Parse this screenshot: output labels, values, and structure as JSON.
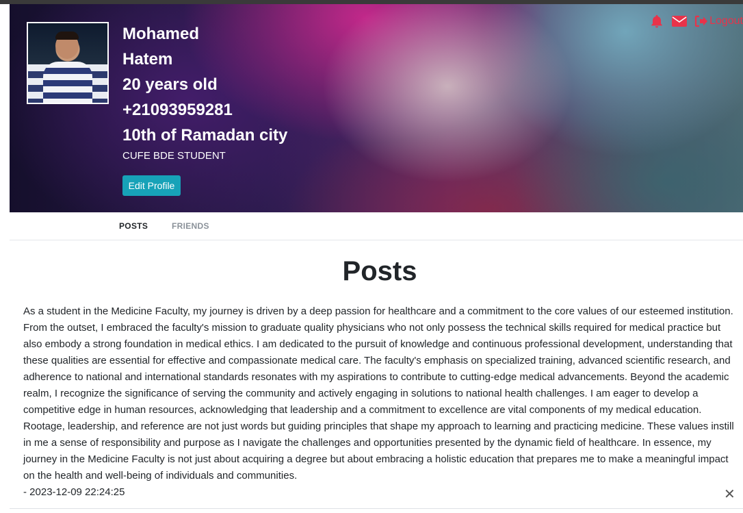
{
  "profile": {
    "first_name": "Mohamed",
    "last_name": "Hatem",
    "age": "20 years old",
    "phone": "+21093959281",
    "city": "10th of Ramadan city",
    "bio": "CUFE BDE STUDENT",
    "edit_button": "Edit Profile"
  },
  "header_actions": {
    "notifications_icon": "bell-icon",
    "messages_icon": "envelope-icon",
    "logout_icon": "sign-out-icon",
    "logout_label": "Logout",
    "accent_color": "#e8334a"
  },
  "tabs": [
    {
      "label": "POSTS",
      "active": true
    },
    {
      "label": "FRIENDS",
      "active": false
    }
  ],
  "posts_section": {
    "title": "Posts",
    "posts": [
      {
        "body": "As a student in the Medicine Faculty, my journey is driven by a deep passion for healthcare and a commitment to the core values of our esteemed institution. From the outset, I embraced the faculty's mission to graduate quality physicians who not only possess the technical skills required for medical practice but also embody a strong foundation in medical ethics. I am dedicated to the pursuit of knowledge and continuous professional development, understanding that these qualities are essential for effective and compassionate medical care. The faculty's emphasis on specialized training, advanced scientific research, and adherence to national and international standards resonates with my aspirations to contribute to cutting-edge medical advancements. Beyond the academic realm, I recognize the significance of serving the community and actively engaging in solutions to national health challenges. I am eager to develop a competitive edge in human resources, acknowledging that leadership and a commitment to excellence are vital components of my medical education. Rootage, leadership, and reference are not just words but guiding principles that shape my approach to learning and practicing medicine. These values instill in me a sense of responsibility and purpose as I navigate the challenges and opportunities presented by the dynamic field of healthcare. In essence, my journey in the Medicine Faculty is not just about acquiring a degree but about embracing a holistic education that prepares me to make a meaningful impact on the health and well-being of individuals and communities.",
        "timestamp": "- 2023-12-09 22:24:25",
        "delete_icon": "close-icon",
        "delete_symbol": "✕"
      }
    ]
  },
  "colors": {
    "button": "#17a2b8",
    "accent": "#e8334a"
  }
}
